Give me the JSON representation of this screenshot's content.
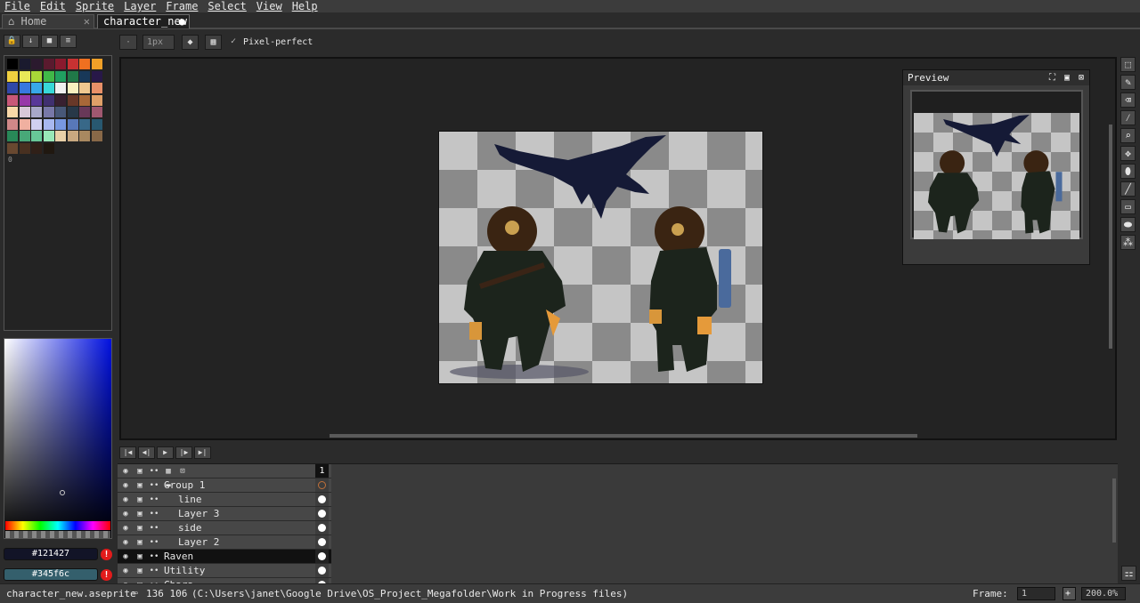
{
  "menu": [
    "File",
    "Edit",
    "Sprite",
    "Layer",
    "Frame",
    "Select",
    "View",
    "Help"
  ],
  "tabs": {
    "home": "Home",
    "active": "character_new"
  },
  "left_toolbar": [
    "lock-icon",
    "download-icon",
    "square-icon",
    "menu-icon"
  ],
  "palette_count": "0",
  "context_bar": {
    "brush_size": "1px",
    "pixel_perfect": "Pixel-perfect"
  },
  "colors": {
    "foreground": "#121427",
    "background": "#345f6c"
  },
  "preview": {
    "title": "Preview"
  },
  "timeline": {
    "frame_header": "1",
    "layers": [
      {
        "name": "Group 1",
        "indent": 0,
        "selected": false,
        "group": true
      },
      {
        "name": "line",
        "indent": 1,
        "selected": false,
        "group": false
      },
      {
        "name": "Layer 3",
        "indent": 1,
        "selected": false,
        "group": false
      },
      {
        "name": "side",
        "indent": 1,
        "selected": false,
        "group": false
      },
      {
        "name": "Layer 2",
        "indent": 1,
        "selected": false,
        "group": false
      },
      {
        "name": "Raven",
        "indent": 0,
        "selected": true,
        "group": false
      },
      {
        "name": "Utility",
        "indent": 0,
        "selected": false,
        "group": false
      },
      {
        "name": "Chara",
        "indent": 0,
        "selected": false,
        "group": false
      }
    ]
  },
  "status": {
    "filename": "character_new.aseprite",
    "dimensions": "136 106",
    "path": "(C:\\Users\\janet\\Google Drive\\OS_Project_Megafolder\\Work in Progress files)",
    "frame_label": "Frame:",
    "frame_value": "1",
    "zoom": "200.0%"
  }
}
